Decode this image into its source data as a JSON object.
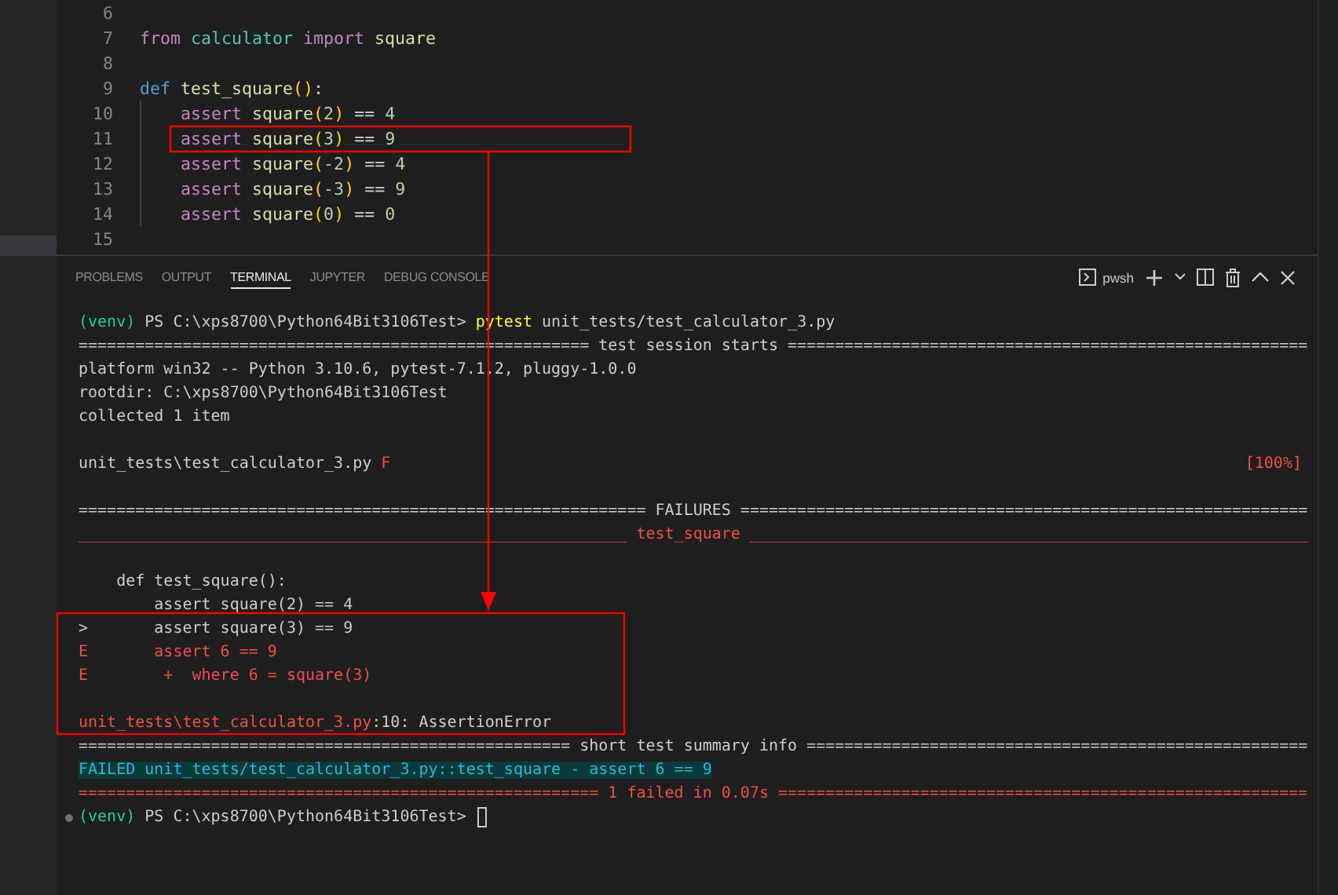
{
  "editor": {
    "lines": [
      {
        "number": "6",
        "indented": false
      },
      {
        "number": "7",
        "indented": false,
        "tokens": [
          {
            "text": "from",
            "kind": "keyword"
          },
          {
            "text": " calculator",
            "kind": "module"
          },
          {
            "text": " import",
            "kind": "keyword"
          },
          {
            "text": " square",
            "kind": "function"
          }
        ]
      },
      {
        "number": "8",
        "indented": false
      },
      {
        "number": "9",
        "indented": false,
        "tokens": [
          {
            "text": "def",
            "kind": "storage"
          },
          {
            "text": " test_square",
            "kind": "function"
          },
          {
            "text": "()",
            "kind": "paren"
          },
          {
            "text": ":",
            "kind": "plain"
          }
        ]
      },
      {
        "number": "10",
        "indented": true,
        "tokens": [
          {
            "text": "assert",
            "kind": "keyword"
          },
          {
            "text": " square",
            "kind": "function"
          },
          {
            "text": "(",
            "kind": "paren"
          },
          {
            "text": "2",
            "kind": "number"
          },
          {
            "text": ")",
            "kind": "paren"
          },
          {
            "text": " == ",
            "kind": "plain"
          },
          {
            "text": "4",
            "kind": "number"
          }
        ]
      },
      {
        "number": "11",
        "indented": true,
        "tokens": [
          {
            "text": "assert",
            "kind": "keyword"
          },
          {
            "text": " square",
            "kind": "function"
          },
          {
            "text": "(",
            "kind": "paren"
          },
          {
            "text": "3",
            "kind": "number"
          },
          {
            "text": ")",
            "kind": "paren"
          },
          {
            "text": " == ",
            "kind": "plain"
          },
          {
            "text": "9",
            "kind": "number"
          }
        ]
      },
      {
        "number": "12",
        "indented": true,
        "tokens": [
          {
            "text": "assert",
            "kind": "keyword"
          },
          {
            "text": " square",
            "kind": "function"
          },
          {
            "text": "(",
            "kind": "paren"
          },
          {
            "text": "-2",
            "kind": "number"
          },
          {
            "text": ")",
            "kind": "paren"
          },
          {
            "text": " == ",
            "kind": "plain"
          },
          {
            "text": "4",
            "kind": "number"
          }
        ]
      },
      {
        "number": "13",
        "indented": true,
        "tokens": [
          {
            "text": "assert",
            "kind": "keyword"
          },
          {
            "text": " square",
            "kind": "function"
          },
          {
            "text": "(",
            "kind": "paren"
          },
          {
            "text": "-3",
            "kind": "number"
          },
          {
            "text": ")",
            "kind": "paren"
          },
          {
            "text": " == ",
            "kind": "plain"
          },
          {
            "text": "9",
            "kind": "number"
          }
        ]
      },
      {
        "number": "14",
        "indented": true,
        "tokens": [
          {
            "text": "assert",
            "kind": "keyword"
          },
          {
            "text": " square",
            "kind": "function"
          },
          {
            "text": "(",
            "kind": "paren"
          },
          {
            "text": "0",
            "kind": "number"
          },
          {
            "text": ")",
            "kind": "paren"
          },
          {
            "text": " == ",
            "kind": "plain"
          },
          {
            "text": "0",
            "kind": "number"
          }
        ]
      },
      {
        "number": "15",
        "indented": false
      }
    ]
  },
  "panel": {
    "tabs": [
      {
        "label": "PROBLEMS",
        "selected": false
      },
      {
        "label": "OUTPUT",
        "selected": false
      },
      {
        "label": "TERMINAL",
        "selected": true
      },
      {
        "label": "JUPYTER",
        "selected": false
      },
      {
        "label": "DEBUG CONSOLE",
        "selected": false
      }
    ],
    "shell": "pwsh"
  },
  "terminal": {
    "lines": [
      {
        "kind": "text",
        "segments": [
          {
            "text": "(venv)",
            "kind": "env"
          },
          {
            "text": " PS C:\\xps8700\\Python64Bit3106Test> ",
            "kind": "plain"
          },
          {
            "text": "pytest",
            "kind": "command"
          },
          {
            "text": " unit_tests/test_calculator_3.py",
            "kind": "plain"
          }
        ]
      },
      {
        "kind": "text",
        "segments": [
          {
            "text": "====================================================== test session starts =======================================================",
            "kind": "plain"
          }
        ]
      },
      {
        "kind": "text",
        "segments": [
          {
            "text": "platform win32 -- Python 3.10.6, pytest-7.1.2, pluggy-1.0.0",
            "kind": "plain"
          }
        ]
      },
      {
        "kind": "text",
        "segments": [
          {
            "text": "rootdir: C:\\xps8700\\Python64Bit3106Test",
            "kind": "plain"
          }
        ]
      },
      {
        "kind": "text",
        "segments": [
          {
            "text": "collected 1 item",
            "kind": "plain"
          }
        ]
      },
      {
        "kind": "blank"
      },
      {
        "kind": "text",
        "segments": [
          {
            "text": "unit_tests\\test_calculator_3.py ",
            "kind": "plain"
          },
          {
            "text": "F",
            "kind": "error"
          }
        ],
        "right": {
          "text": "[100%]",
          "kind": "error"
        }
      },
      {
        "kind": "blank"
      },
      {
        "kind": "text",
        "segments": [
          {
            "text": "============================================================ FAILURES ============================================================",
            "kind": "plain"
          }
        ]
      },
      {
        "kind": "text",
        "segments": [
          {
            "text": "__________________________________________________________ test_square ___________________________________________________________",
            "kind": "error"
          }
        ]
      },
      {
        "kind": "blank"
      },
      {
        "kind": "text",
        "segments": [
          {
            "text": "    def test_square():",
            "kind": "plain"
          }
        ]
      },
      {
        "kind": "text",
        "segments": [
          {
            "text": "        assert square(2) == 4",
            "kind": "plain"
          }
        ]
      },
      {
        "kind": "text",
        "segments": [
          {
            "text": ">       assert square(3) == 9",
            "kind": "plain"
          }
        ]
      },
      {
        "kind": "text",
        "segments": [
          {
            "text": "E       assert 6 == 9",
            "kind": "error"
          }
        ]
      },
      {
        "kind": "text",
        "segments": [
          {
            "text": "E        +  where 6 = square(3)",
            "kind": "error"
          }
        ]
      },
      {
        "kind": "blank"
      },
      {
        "kind": "text",
        "segments": [
          {
            "text": "unit_tests\\test_calculator_3.py",
            "kind": "error"
          },
          {
            "text": ":10: AssertionError",
            "kind": "plain"
          }
        ]
      },
      {
        "kind": "text",
        "segments": [
          {
            "text": "==================================================== short test summary info =====================================================",
            "kind": "plain"
          }
        ]
      },
      {
        "kind": "text",
        "segments": [
          {
            "text": "FAILED unit_tests/test_calculator_3.py::test_square - assert 6 == 9",
            "kind": "failed"
          }
        ]
      },
      {
        "kind": "text",
        "segments": [
          {
            "text": "======================================================= 1 failed in 0.07s ========================================================",
            "kind": "error"
          }
        ]
      },
      {
        "kind": "prompt",
        "segments": [
          {
            "text": "(venv)",
            "kind": "env"
          },
          {
            "text": " PS C:\\xps8700\\Python64Bit3106Test> ",
            "kind": "plain"
          }
        ]
      }
    ]
  }
}
